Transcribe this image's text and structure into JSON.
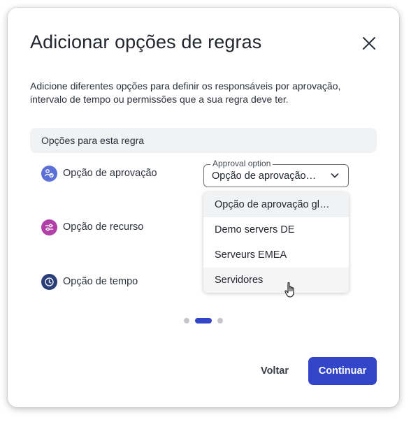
{
  "dialog": {
    "title": "Adicionar opções de regras",
    "description": "Adicione diferentes opções para definir os responsáveis por aprovação, intervalo de tempo ou permissões que a sua regra deve ter.",
    "close_icon": "close-icon"
  },
  "section": {
    "header": "Opções para esta regra"
  },
  "options": [
    {
      "label": "Opção de aprovação",
      "icon": "approval-users-icon",
      "color": "#5b6fd6"
    },
    {
      "label": "Opção de recurso",
      "icon": "sliders-icon",
      "color": "#b040a8"
    },
    {
      "label": "Opção de tempo",
      "icon": "clock-icon",
      "color": "#2a3f78"
    }
  ],
  "approval_select": {
    "label": "Approval option",
    "value": "Opção de aprovação ...",
    "icon": "chevron-down-icon",
    "menu_items": [
      "Opção de aprovação glo...",
      "Demo servers DE",
      "Serveurs EMEA",
      "Servidores"
    ],
    "selected_index": 0,
    "hovered_index": 3
  },
  "pager": {
    "total": 3,
    "active_index": 1
  },
  "footer": {
    "back_label": "Voltar",
    "continue_label": "Continuar"
  },
  "colors": {
    "accent": "#3345c8",
    "section_bg": "#f1f2f4"
  }
}
